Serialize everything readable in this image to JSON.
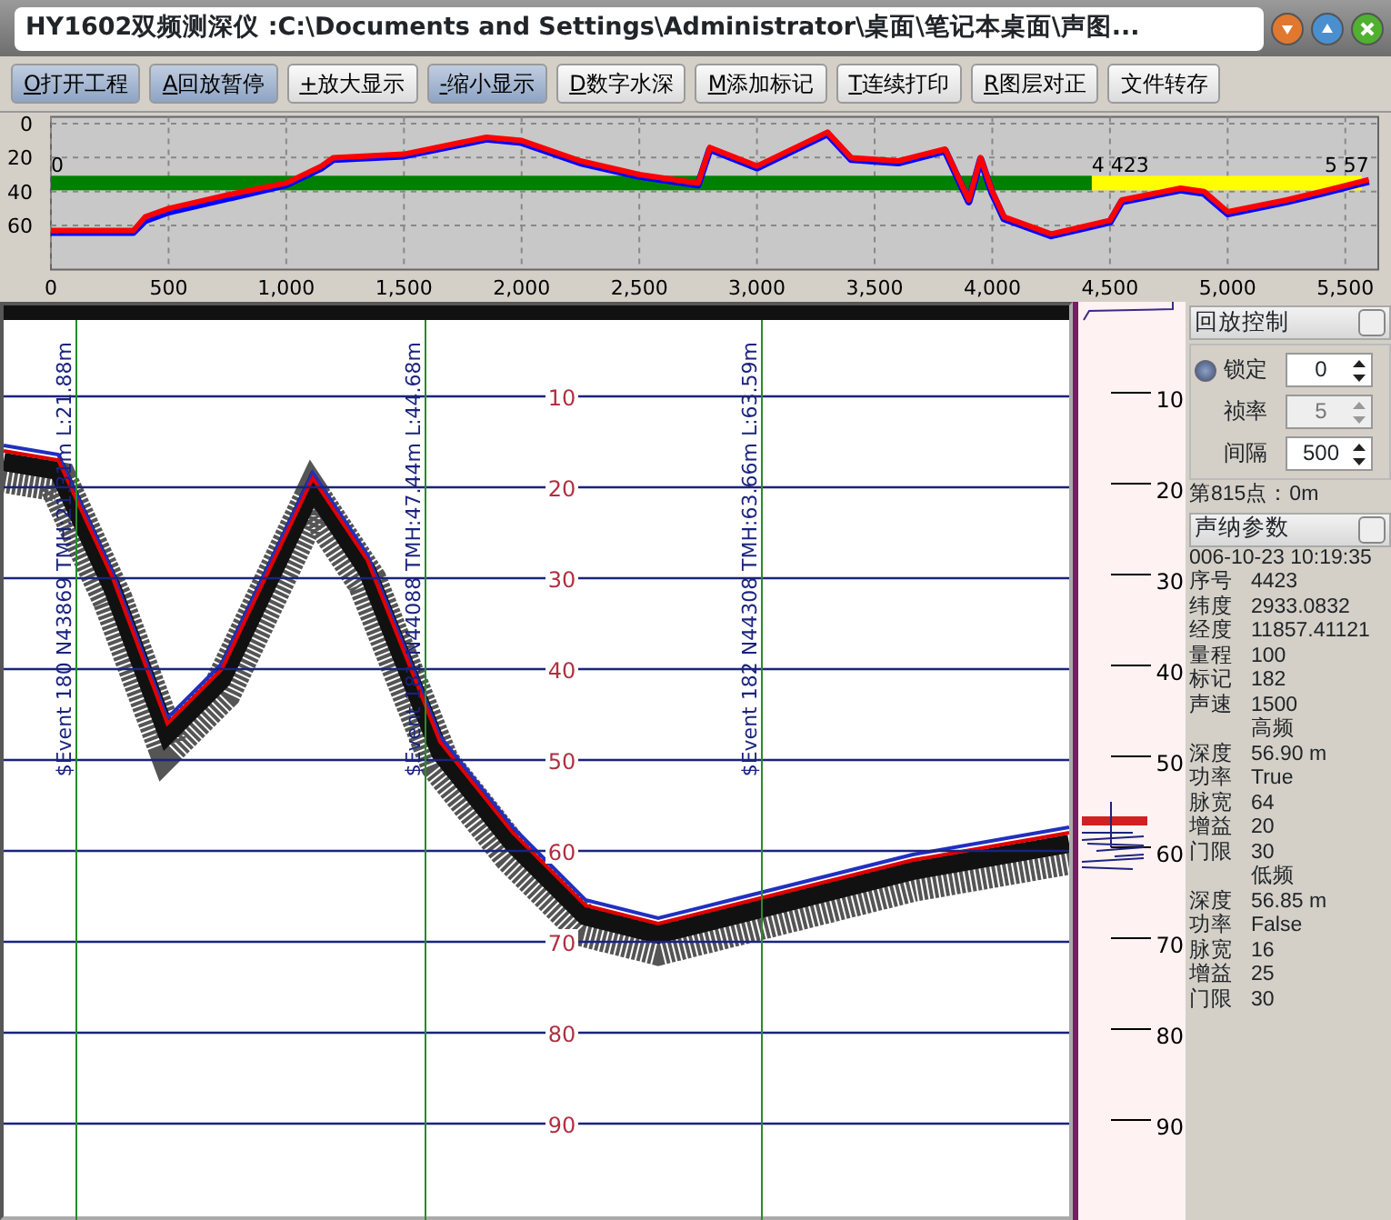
{
  "window": {
    "title": "HY1602双频测深仪 :C:\\Documents and Settings\\Administrator\\桌面\\笔记本桌面\\声图..."
  },
  "toolbar": [
    {
      "key": "O",
      "label": "打开工程",
      "selected": true
    },
    {
      "key": "A",
      "label": "回放暂停",
      "selected": true
    },
    {
      "key": "+",
      "label": "放大显示",
      "selected": false
    },
    {
      "key": "-",
      "label": "缩小显示",
      "selected": true
    },
    {
      "key": "D",
      "label": "数字水深",
      "selected": false
    },
    {
      "key": "M",
      "label": "添加标记",
      "selected": false
    },
    {
      "key": "T",
      "label": "连续打印",
      "selected": false
    },
    {
      "key": "R",
      "label": "图层对正",
      "selected": false
    },
    {
      "label": "文件转存",
      "selected": false
    }
  ],
  "track_chart": {
    "chart_data": {
      "type": "line",
      "x": [
        0,
        350,
        400,
        500,
        750,
        1000,
        1150,
        1200,
        1500,
        1850,
        2000,
        2250,
        2500,
        2750,
        2800,
        3000,
        3300,
        3400,
        3600,
        3800,
        3900,
        3950,
        4000,
        4050,
        4250,
        4500,
        4550,
        4800,
        4900,
        5000,
        5250,
        5400,
        5600
      ],
      "series": [
        {
          "color": "#0000ff",
          "values": [
            64,
            64,
            57,
            52,
            44,
            36,
            26,
            21,
            19,
            9,
            11,
            23,
            31,
            36,
            15,
            26,
            6,
            21,
            23,
            16,
            46,
            21,
            41,
            56,
            66,
            58,
            46,
            39,
            41,
            53,
            46,
            41,
            34
          ]
        },
        {
          "color": "#ff0000",
          "values": [
            63,
            63,
            55,
            50,
            42,
            35,
            25,
            20,
            18,
            8,
            10,
            22,
            30,
            35,
            14,
            25,
            5,
            20,
            22,
            15,
            45,
            20,
            40,
            55,
            65,
            57,
            45,
            38,
            40,
            52,
            45,
            40,
            33
          ]
        }
      ],
      "xlim": [
        0,
        5640
      ],
      "ylim": [
        86,
        -4
      ],
      "grid": true,
      "xticks": [
        {
          "value": 0,
          "label": "0"
        },
        {
          "value": 500,
          "label": "500"
        },
        {
          "value": 1000,
          "label": "1,000"
        },
        {
          "value": 1500,
          "label": "1,500"
        },
        {
          "value": 2000,
          "label": "2,000"
        },
        {
          "value": 2500,
          "label": "2,500"
        },
        {
          "value": 3000,
          "label": "3,000"
        },
        {
          "value": 3500,
          "label": "3,500"
        },
        {
          "value": 4000,
          "label": "4,000"
        },
        {
          "value": 4500,
          "label": "4,500"
        },
        {
          "value": 5000,
          "label": "5,000"
        },
        {
          "value": 5500,
          "label": "5,500"
        }
      ],
      "yticks": [
        0,
        20,
        40,
        60
      ]
    },
    "progress": {
      "level": 0.794,
      "start_label": "0",
      "position_label": "4 423",
      "end_label": "5 57"
    }
  },
  "echogram": {
    "depth_labels": [
      "10",
      "20",
      "30",
      "40",
      "50",
      "60",
      "70",
      "80",
      "90"
    ],
    "events": [
      {
        "label": "$Event 180 N43869 TMH:21.31m L:21.88m"
      },
      {
        "label": "$Event 181 N44088 TMH:47.44m L:44.68m"
      },
      {
        "label": "$Event 182 N44308 TMH:63.66m L:63.59m"
      }
    ]
  },
  "depth_scale": [
    "10",
    "20",
    "30",
    "40",
    "50",
    "60",
    "70",
    "80",
    "90"
  ],
  "playback": {
    "title": "回放控制",
    "checked": false,
    "rows": [
      {
        "kind": "radio",
        "label": "锁定",
        "value": "0",
        "checked": true,
        "disabled": false
      },
      {
        "kind": "plain",
        "label": "祯率",
        "value": "5",
        "disabled": true
      },
      {
        "kind": "plain",
        "label": "间隔",
        "value": "500",
        "disabled": false
      }
    ],
    "point": "第815点：0m"
  },
  "sonar": {
    "title": "声纳参数",
    "checked": false,
    "lines": [
      {
        "kind": "text",
        "text": "006-10-23 10:19:35"
      },
      {
        "kind": "param",
        "label": "序号",
        "value": "4423"
      },
      {
        "kind": "param",
        "label": "纬度",
        "value": "2933.0832"
      },
      {
        "kind": "param",
        "label": "经度",
        "value": "11857.41121"
      },
      {
        "kind": "param",
        "label": "量程",
        "value": "100"
      },
      {
        "kind": "param",
        "label": "标记",
        "value": "182"
      },
      {
        "kind": "param",
        "label": "声速",
        "value": "1500"
      },
      {
        "kind": "heading",
        "text": "高频"
      },
      {
        "kind": "param",
        "label": "深度",
        "value": "56.90 m"
      },
      {
        "kind": "param",
        "label": "功率",
        "value": "True"
      },
      {
        "kind": "param",
        "label": "脉宽",
        "value": "64"
      },
      {
        "kind": "param",
        "label": "增益",
        "value": "20"
      },
      {
        "kind": "param",
        "label": "门限",
        "value": "30"
      },
      {
        "kind": "heading",
        "text": "低频"
      },
      {
        "kind": "param",
        "label": "深度",
        "value": "56.85 m"
      },
      {
        "kind": "param",
        "label": "功率",
        "value": "False"
      },
      {
        "kind": "param",
        "label": "脉宽",
        "value": "16"
      },
      {
        "kind": "param",
        "label": "增益",
        "value": "25"
      },
      {
        "kind": "param",
        "label": "门限",
        "value": "30"
      }
    ]
  }
}
